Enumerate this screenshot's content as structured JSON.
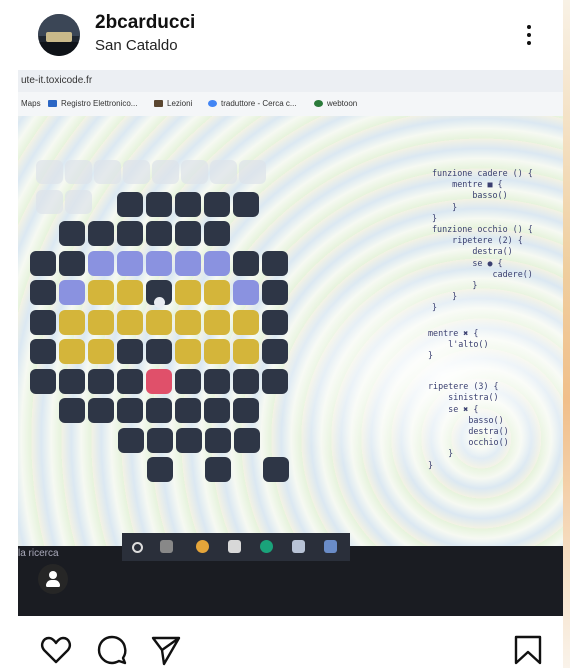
{
  "post": {
    "username": "2bcarducci",
    "location": "San Cataldo"
  },
  "screenshot": {
    "url": "ute-it.toxicode.fr",
    "bookmarks": [
      "Maps",
      "Registro Elettronico...",
      "Lezioni",
      "traduttore - Cerca c...",
      "webtoon"
    ],
    "search_hint": "la ricerca",
    "code_lines": [
      "funzione cadere () {",
      "    mentre ■ {",
      "        basso()",
      "    }",
      "}",
      "funzione occhio () {",
      "    ripetere (2) {",
      "        destra()",
      "        se ● {",
      "            cadere()",
      "        }",
      "    }",
      "}",
      "mentre ✖ {",
      "    l'alto()",
      "}",
      "ripetere (3) {",
      "    sinistra()",
      "    se ✖ {",
      "        basso()",
      "        destra()",
      "        occhio()",
      "    }",
      "}"
    ]
  },
  "colors": {
    "cell_dark": "#2e3646",
    "cell_purple": "#8a92e0",
    "cell_yellow": "#d4b53a",
    "cell_red": "#e0506a"
  },
  "icons": [
    "more-options-icon",
    "heart-icon",
    "comment-icon",
    "share-icon",
    "bookmark-icon",
    "user-tag-icon"
  ]
}
